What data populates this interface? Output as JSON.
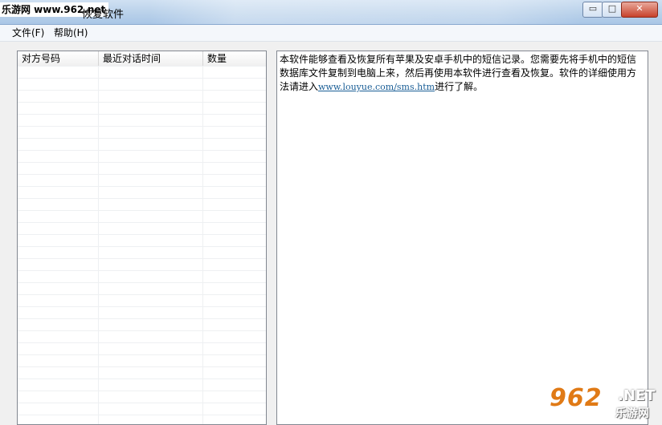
{
  "window": {
    "watermark_top": "乐游网 www.962.net",
    "title": "恢复软件",
    "minimize_glyph": "▭",
    "maximize_glyph": "□",
    "close_glyph": "✕"
  },
  "menu": {
    "items": [
      {
        "label": "文件(F)"
      },
      {
        "label": "帮助(H)"
      }
    ]
  },
  "list": {
    "columns": [
      "对方号码",
      "最近对话时间",
      "数量"
    ],
    "rows": []
  },
  "info": {
    "text_before": "本软件能够查看及恢复所有苹果及安卓手机中的短信记录。您需要先将手机中的短信数据库文件复制到电脑上来，然后再使用本软件进行查看及恢复。软件的详细使用方法请进入",
    "link": "www.louyue.com/sms.htm",
    "text_after": "进行了解。"
  },
  "watermark_logo": {
    "number": "962",
    "net": ".NET",
    "site": "乐游网"
  },
  "colors": {
    "titlebar": "#b9d1ea",
    "link": "#1a5e96",
    "watermark_orange": "#e07a16"
  }
}
